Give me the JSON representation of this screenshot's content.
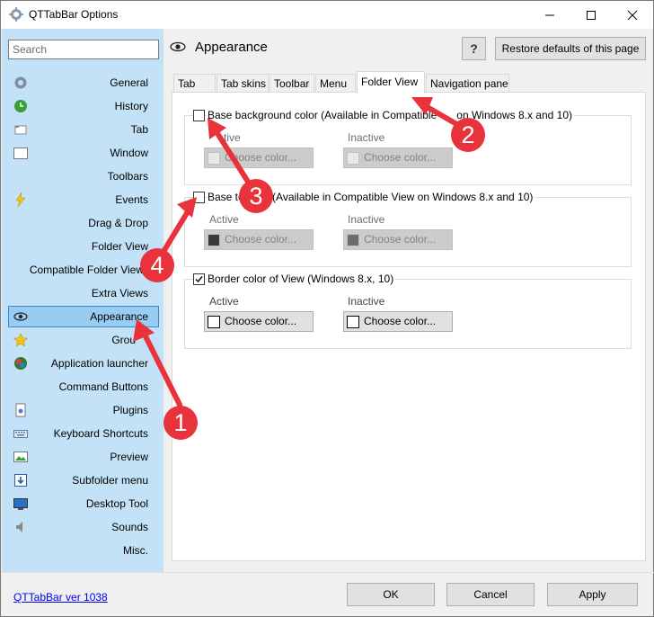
{
  "window": {
    "title": "QTTabBar Options"
  },
  "colors": {
    "sidebar_bg": "#c3e2f7",
    "selected_bg": "#99ccf1",
    "annotation_red": "#e8323c"
  },
  "search": {
    "placeholder": "Search"
  },
  "sidebar": {
    "items": [
      {
        "label": "General",
        "icon": "gear-icon"
      },
      {
        "label": "History",
        "icon": "history-icon"
      },
      {
        "label": "Tab",
        "icon": "tab-icon"
      },
      {
        "label": "Window",
        "icon": "window-icon"
      },
      {
        "label": "Toolbars",
        "icon": ""
      },
      {
        "label": "Events",
        "icon": "lightning-icon"
      },
      {
        "label": "Drag & Drop",
        "icon": ""
      },
      {
        "label": "Folder View",
        "icon": ""
      },
      {
        "label": "Compatible Folder View",
        "icon": ""
      },
      {
        "label": "Extra Views",
        "icon": ""
      },
      {
        "label": "Appearance",
        "icon": "eye-icon",
        "selected": true
      },
      {
        "label": "Grou",
        "icon": "star-icon"
      },
      {
        "label": "Application launcher",
        "icon": "globe-icon"
      },
      {
        "label": "Command Buttons",
        "icon": ""
      },
      {
        "label": "Plugins",
        "icon": "plugin-icon"
      },
      {
        "label": "Keyboard Shortcuts",
        "icon": "keyboard-icon"
      },
      {
        "label": "Preview",
        "icon": "preview-icon"
      },
      {
        "label": "Subfolder menu",
        "icon": "subfolder-icon"
      },
      {
        "label": "Desktop Tool",
        "icon": "desktop-icon"
      },
      {
        "label": "Sounds",
        "icon": "speaker-icon"
      },
      {
        "label": "Misc.",
        "icon": ""
      }
    ]
  },
  "header": {
    "title": "Appearance",
    "help_label": "?",
    "restore_label": "Restore defaults of this page"
  },
  "tabs": [
    {
      "label": "Tab"
    },
    {
      "label": "Tab skins"
    },
    {
      "label": "Toolbar"
    },
    {
      "label": "Menu"
    },
    {
      "label": "Folder View",
      "active": true
    },
    {
      "label": "Navigation pane"
    }
  ],
  "groups": [
    {
      "title": "Base background color (Available in Compatible",
      "title_tail": "on Windows 8.x and 10)",
      "checked": false,
      "active_label": "tive",
      "inactive_label": "Inactive",
      "active_button": "Choose color...",
      "inactive_button": "Choose color...",
      "active_color": "#e8e8e8",
      "inactive_color": "#e8e8e8"
    },
    {
      "title": "Base te",
      "title_tail": "r (Available in Compatible View on Windows 8.x and 10)",
      "checked": false,
      "active_label": "Active",
      "inactive_label": "Inactive",
      "active_button": "Choose color...",
      "inactive_button": "Choose color...",
      "active_color": "#3c3c3c",
      "inactive_color": "#6d6d6d"
    },
    {
      "title": "Border color of View (Windows 8.x, 10)",
      "checked": true,
      "active_label": "Active",
      "inactive_label": "Inactive",
      "active_button": "Choose color...",
      "inactive_button": "Choose color...",
      "active_color": "#ffffff",
      "inactive_color": "#ffffff"
    }
  ],
  "footer": {
    "version_label": "QTTabBar ver 1038",
    "ok_label": "OK",
    "cancel_label": "Cancel",
    "apply_label": "Apply"
  },
  "annotations": [
    {
      "label": "1"
    },
    {
      "label": "2"
    },
    {
      "label": "3"
    },
    {
      "label": "4"
    }
  ]
}
